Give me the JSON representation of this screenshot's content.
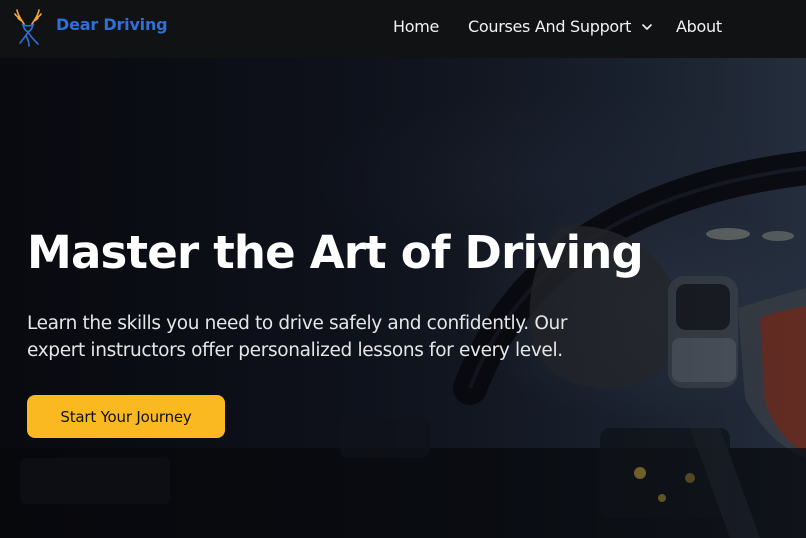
{
  "brand": {
    "name": "Dear Driving",
    "logo_icon": "deer-head-icon"
  },
  "nav": {
    "items": [
      {
        "label": "Home"
      },
      {
        "label": "Courses And Support",
        "icon": "chevron-down-icon"
      },
      {
        "label": "About"
      }
    ]
  },
  "hero": {
    "title": "Master the Art of Driving",
    "subtitle": "Learn the skills you need to drive safely and confidently. Our expert instructors offer personalized lessons for every level.",
    "cta_label": "Start Your Journey"
  },
  "colors": {
    "accent": "#fbb921",
    "brand": "#2f6fd6",
    "nav_bg": "#111214"
  }
}
